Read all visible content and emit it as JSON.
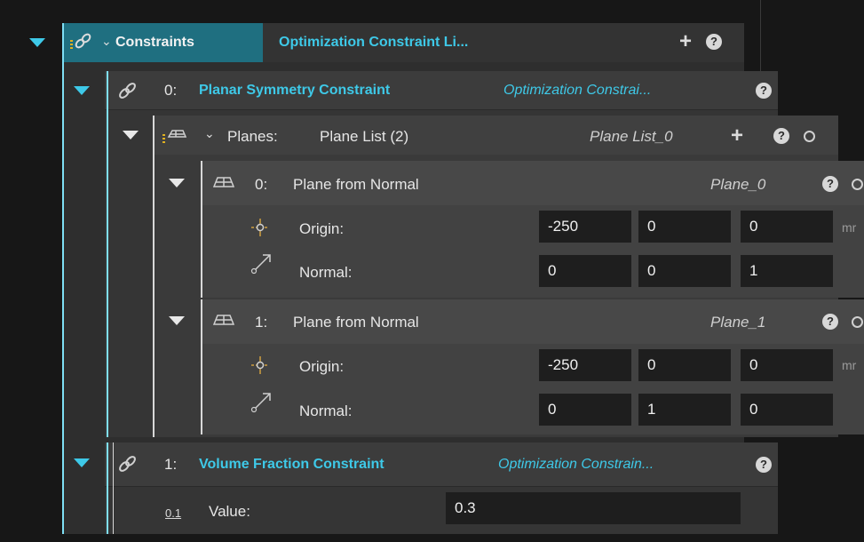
{
  "constraints": {
    "name": "Constraints",
    "type": "Optimization Constraint Li...",
    "items": [
      {
        "index": "0:",
        "name": "Planar Symmetry Constraint",
        "type": "Optimization Constrai...",
        "planes": {
          "name": "Planes:",
          "type": "Plane List (2)",
          "id": "Plane List_0",
          "items": [
            {
              "index": "0:",
              "name": "Plane from Normal",
              "id": "Plane_0",
              "origin_label": "Origin:",
              "origin": [
                "-250",
                "0",
                "0"
              ],
              "origin_unit": "mr",
              "normal_label": "Normal:",
              "normal": [
                "0",
                "0",
                "1"
              ]
            },
            {
              "index": "1:",
              "name": "Plane from Normal",
              "id": "Plane_1",
              "origin_label": "Origin:",
              "origin": [
                "-250",
                "0",
                "0"
              ],
              "origin_unit": "mr",
              "normal_label": "Normal:",
              "normal": [
                "0",
                "1",
                "0"
              ]
            }
          ]
        }
      },
      {
        "index": "1:",
        "name": "Volume Fraction Constraint",
        "type": "Optimization Constrain...",
        "value_icon": "0.1",
        "value_label": "Value:",
        "value": "0.3"
      }
    ]
  },
  "icons": {
    "help": "?",
    "add": "+"
  },
  "colors": {
    "accent": "#3ec9e8",
    "header_selected": "#1f6f80",
    "panel": "#3b3b3b",
    "background": "#171717"
  }
}
